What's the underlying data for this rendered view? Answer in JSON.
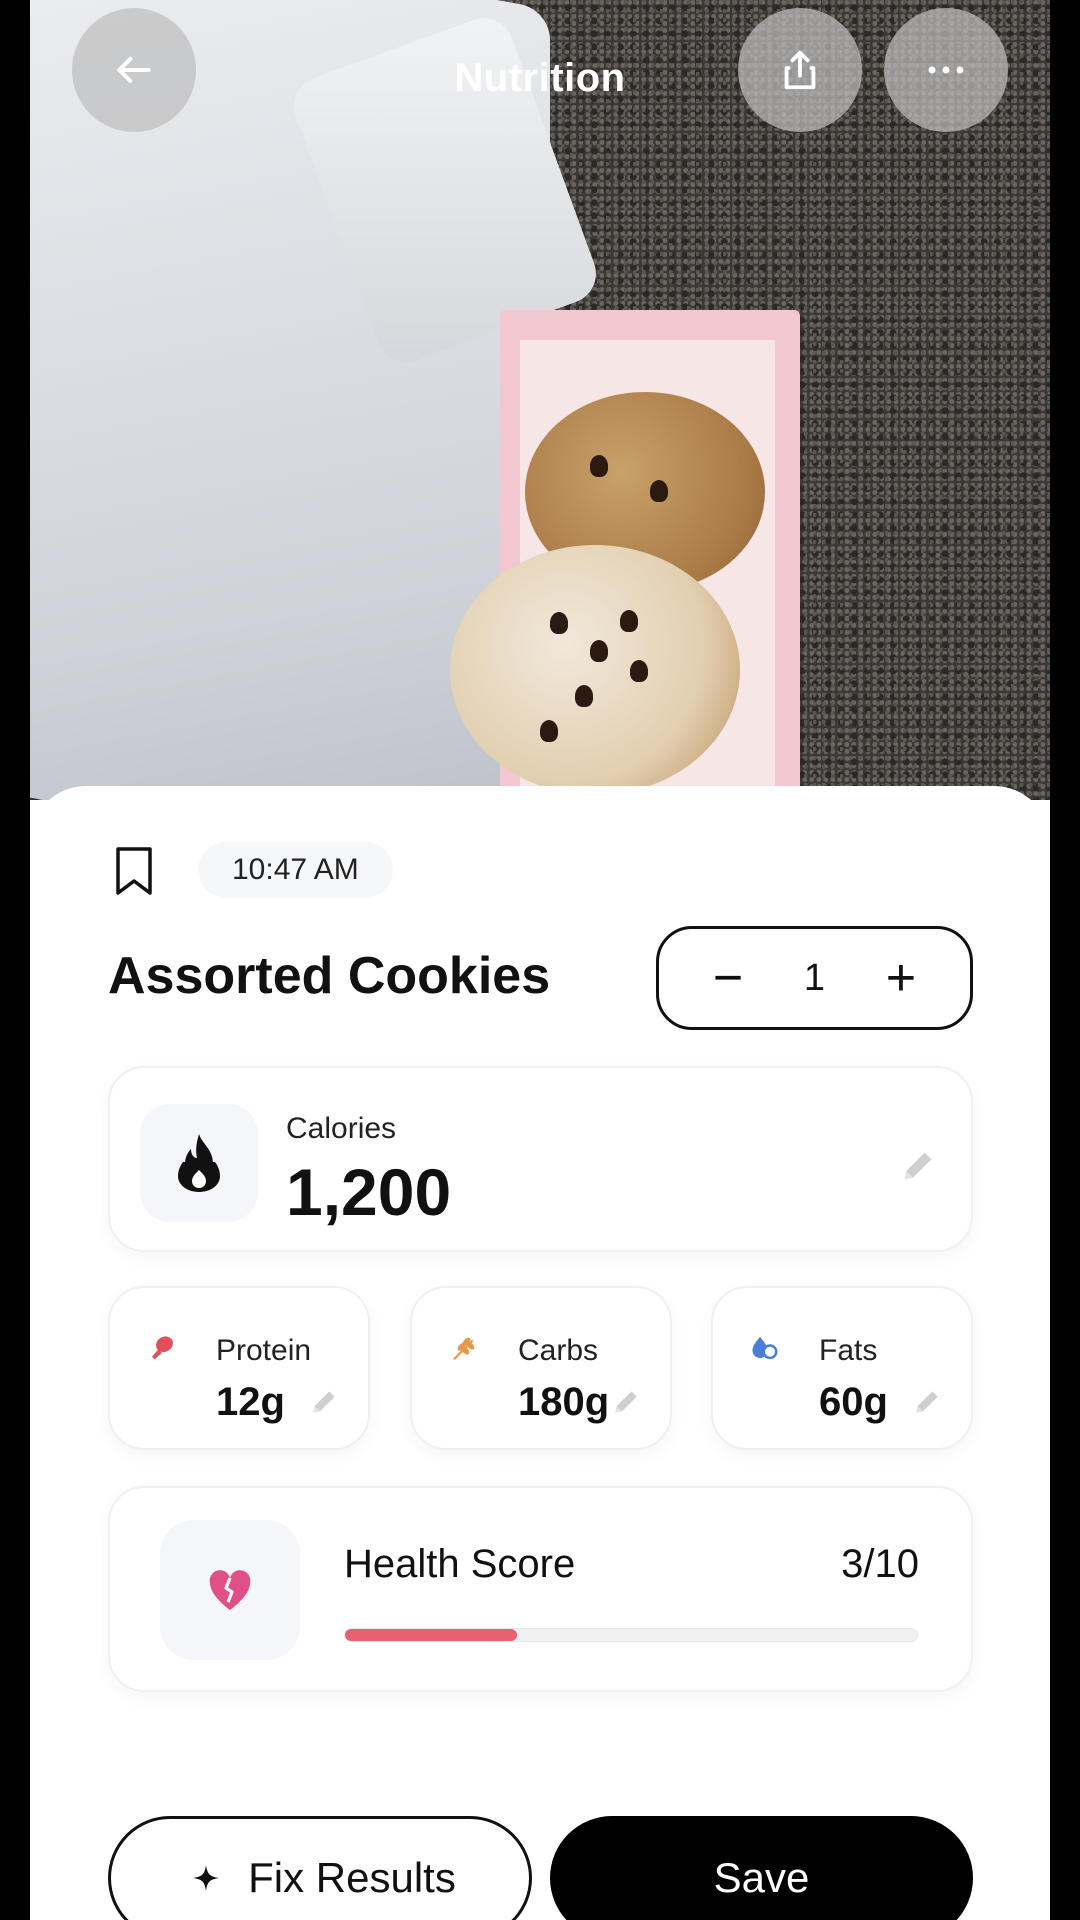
{
  "header": {
    "title": "Nutrition",
    "back_icon": "arrow-left-icon",
    "share_icon": "share-icon",
    "more_icon": "more-horizontal-icon"
  },
  "entry": {
    "time": "10:47 AM",
    "food_name": "Assorted Cookies",
    "quantity": "1"
  },
  "calories": {
    "label": "Calories",
    "value": "1,200"
  },
  "macros": [
    {
      "label": "Protein",
      "value": "12g",
      "color": "#e0505b"
    },
    {
      "label": "Carbs",
      "value": "180g",
      "color": "#e39a4e"
    },
    {
      "label": "Fats",
      "value": "60g",
      "color": "#4a7fd8"
    }
  ],
  "health_score": {
    "label": "Health Score",
    "value": "3/10",
    "fraction": 0.3,
    "bar_color": "#e8616f"
  },
  "actions": {
    "fix_label": "Fix Results",
    "save_label": "Save"
  }
}
